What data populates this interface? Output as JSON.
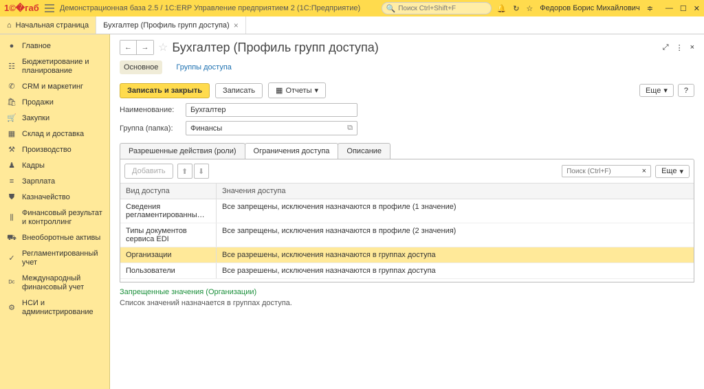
{
  "titlebar": {
    "title": "Демонстрационная база 2.5 / 1С:ERP Управление предприятием 2  (1С:Предприятие)",
    "search_placeholder": "Поиск Ctrl+Shift+F",
    "user": "Федоров Борис Михайлович"
  },
  "tabs": {
    "home": "Начальная страница",
    "current": "Бухгалтер (Профиль групп доступа)"
  },
  "sidebar": [
    {
      "icon": "●",
      "label": "Главное"
    },
    {
      "icon": "☷",
      "label": "Бюджетирование и планирование"
    },
    {
      "icon": "✆",
      "label": "CRM и маркетинг"
    },
    {
      "icon": "🛍",
      "label": "Продажи"
    },
    {
      "icon": "🛒",
      "label": "Закупки"
    },
    {
      "icon": "▦",
      "label": "Склад и доставка"
    },
    {
      "icon": "⚒",
      "label": "Производство"
    },
    {
      "icon": "♟",
      "label": "Кадры"
    },
    {
      "icon": "≡",
      "label": "Зарплата"
    },
    {
      "icon": "⛊",
      "label": "Казначейство"
    },
    {
      "icon": "⫼",
      "label": "Финансовый результат и контроллинг"
    },
    {
      "icon": "⛟",
      "label": "Внеоборотные активы"
    },
    {
      "icon": "✓",
      "label": "Регламентированный учет"
    },
    {
      "icon": "ᴰᶜ",
      "label": "Международный финансовый учет"
    },
    {
      "icon": "⚙",
      "label": "НСИ и администрирование"
    }
  ],
  "page": {
    "title": "Бухгалтер (Профиль групп доступа)",
    "subtabs": {
      "main": "Основное",
      "groups": "Группы доступа"
    },
    "buttons": {
      "save_close": "Записать и закрыть",
      "save": "Записать",
      "reports": "Отчеты",
      "more": "Еще",
      "help": "?"
    },
    "fields": {
      "name_label": "Наименование:",
      "name_value": "Бухгалтер",
      "group_label": "Группа (папка):",
      "group_value": "Финансы"
    },
    "inner_tabs": {
      "roles": "Разрешенные действия (роли)",
      "restrict": "Ограничения доступа",
      "desc": "Описание"
    },
    "panel": {
      "add": "Добавить",
      "search_placeholder": "Поиск (Ctrl+F)",
      "more": "Еще",
      "col1": "Вид доступа",
      "col2": "Значения доступа",
      "rows": [
        {
          "c1": "Сведения регламентированны…",
          "c2": "Все запрещены, исключения назначаются в профиле (1 значение)"
        },
        {
          "c1": "Типы документов сервиса EDI",
          "c2": "Все запрещены, исключения назначаются в профиле (2 значения)"
        },
        {
          "c1": "Организации",
          "c2": "Все разрешены, исключения назначаются в группах доступа"
        },
        {
          "c1": "Пользователи",
          "c2": "Все разрешены, исключения назначаются в группах доступа"
        }
      ]
    },
    "detail": {
      "title": "Запрещенные значения (Организации)",
      "text": "Список значений назначается в группах доступа."
    }
  }
}
